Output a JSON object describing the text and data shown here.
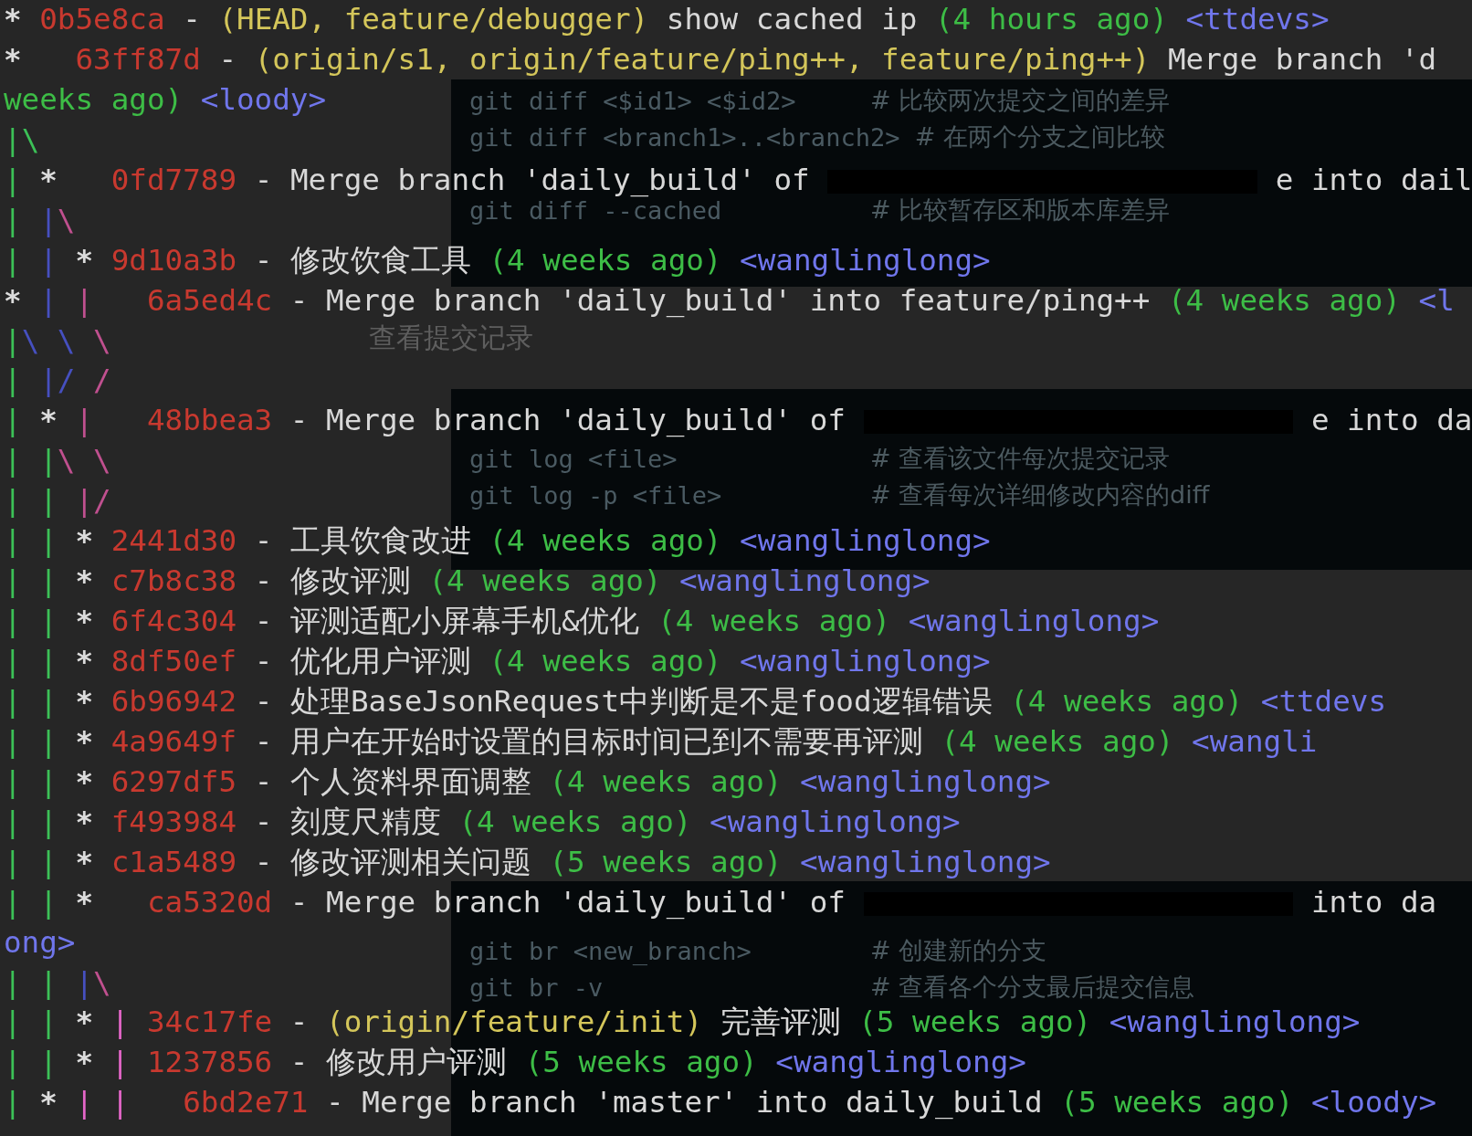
{
  "background_window": {
    "sections": [
      {
        "kind": "code",
        "lines": [
          {
            "code": "git diff <$id1> <$id2>",
            "comment": "# 比较两次提交之间的差异"
          },
          {
            "code": "git diff <branch1>..<branch2>",
            "comment": "# 在两个分支之间比较"
          },
          {
            "code": "git diff --cached",
            "comment": "# 比较暂存区和版本库差异"
          }
        ]
      },
      {
        "kind": "subheading",
        "text": "查看提交记录"
      },
      {
        "kind": "code",
        "lines": [
          {
            "code": "git log <file>",
            "comment": "# 查看该文件每次提交记录"
          },
          {
            "code": "git log -p <file>",
            "comment": "# 查看每次详细修改内容的diff"
          }
        ]
      },
      {
        "kind": "code",
        "lines": [
          {
            "code": "git br <new_branch>",
            "comment": "# 创建新的分支"
          },
          {
            "code": "git br -v",
            "comment": "# 查看各个分支最后提交信息"
          }
        ]
      }
    ]
  },
  "terminal": {
    "rows": [
      {
        "graph": [
          {
            "kind": "node",
            "text": "* ",
            "color": "#dcdcdc"
          }
        ],
        "parts": [
          {
            "kind": "hash",
            "text": "0b5e8ca"
          },
          {
            "kind": "dash",
            "text": "-"
          },
          {
            "kind": "refs",
            "text": "(HEAD, feature/debugger)"
          },
          {
            "kind": "message",
            "text": "show cached ip"
          },
          {
            "kind": "date",
            "text": "(4 hours ago)"
          },
          {
            "kind": "author",
            "text": "<ttdevs>"
          }
        ]
      },
      {
        "graph": [
          {
            "kind": "node",
            "text": "*   ",
            "color": "#dcdcdc"
          }
        ],
        "parts": [
          {
            "kind": "hash",
            "text": "63ff87d"
          },
          {
            "kind": "dash",
            "text": "-"
          },
          {
            "kind": "refs",
            "text": "(origin/s1, origin/feature/ping++, feature/ping++)"
          },
          {
            "kind": "message",
            "text": "Merge branch 'd"
          }
        ]
      },
      {
        "graph": [],
        "parts": [
          {
            "kind": "date",
            "text": "weeks ago)"
          },
          {
            "kind": "author",
            "text": "<loody>"
          }
        ]
      },
      {
        "graph": [
          {
            "kind": "line",
            "text": "|",
            "color": "#3cc157"
          },
          {
            "kind": "line",
            "text": "\\",
            "color": "#3cc157"
          }
        ],
        "parts": []
      },
      {
        "graph": [
          {
            "kind": "line",
            "text": "| ",
            "color": "#3cc157"
          },
          {
            "kind": "node",
            "text": "*   ",
            "color": "#dcdcdc"
          }
        ],
        "parts": [
          {
            "kind": "hash",
            "text": "0fd7789"
          },
          {
            "kind": "dash",
            "text": "-"
          },
          {
            "kind": "message",
            "text": "Merge branch 'daily_build' of"
          },
          {
            "kind": "redacted"
          },
          {
            "kind": "message",
            "text": "e into dail"
          }
        ]
      },
      {
        "graph": [
          {
            "kind": "line",
            "text": "| ",
            "color": "#3cc157"
          },
          {
            "kind": "line",
            "text": "|",
            "color": "#4650c0"
          },
          {
            "kind": "line",
            "text": "\\",
            "color": "#c0508f"
          }
        ],
        "parts": []
      },
      {
        "graph": [
          {
            "kind": "line",
            "text": "| ",
            "color": "#3cc157"
          },
          {
            "kind": "line",
            "text": "| ",
            "color": "#4650c0"
          },
          {
            "kind": "node",
            "text": "* ",
            "color": "#dcdcdc"
          }
        ],
        "parts": [
          {
            "kind": "hash",
            "text": "9d10a3b"
          },
          {
            "kind": "dash",
            "text": "-"
          },
          {
            "kind": "message",
            "text": "修改饮食工具"
          },
          {
            "kind": "date",
            "text": "(4 weeks ago)"
          },
          {
            "kind": "author",
            "text": "<wanglinglong>"
          }
        ]
      },
      {
        "graph": [
          {
            "kind": "node",
            "text": "* ",
            "color": "#dcdcdc"
          },
          {
            "kind": "line",
            "text": "| ",
            "color": "#4650c0"
          },
          {
            "kind": "line",
            "text": "|   ",
            "color": "#c0508f"
          }
        ],
        "parts": [
          {
            "kind": "hash",
            "text": "6a5ed4c"
          },
          {
            "kind": "dash",
            "text": "-"
          },
          {
            "kind": "message",
            "text": "Merge branch 'daily_build' into feature/ping++"
          },
          {
            "kind": "date",
            "text": "(4 weeks ago)"
          },
          {
            "kind": "author",
            "text": "<l"
          }
        ]
      },
      {
        "graph": [
          {
            "kind": "line",
            "text": "|",
            "color": "#3cc157"
          },
          {
            "kind": "line",
            "text": "\\ ",
            "color": "#4650c0"
          },
          {
            "kind": "line",
            "text": "\\ ",
            "color": "#4650c0"
          },
          {
            "kind": "line",
            "text": "\\",
            "color": "#c0508f"
          }
        ],
        "parts": []
      },
      {
        "graph": [
          {
            "kind": "line",
            "text": "| ",
            "color": "#3cc157"
          },
          {
            "kind": "line",
            "text": "|/ ",
            "color": "#4650c0"
          },
          {
            "kind": "line",
            "text": "/",
            "color": "#c0508f"
          }
        ],
        "parts": []
      },
      {
        "graph": [
          {
            "kind": "line",
            "text": "| ",
            "color": "#3cc157"
          },
          {
            "kind": "node",
            "text": "* ",
            "color": "#dcdcdc"
          },
          {
            "kind": "line",
            "text": "|   ",
            "color": "#c0508f"
          }
        ],
        "parts": [
          {
            "kind": "hash",
            "text": "48bbea3"
          },
          {
            "kind": "dash",
            "text": "-"
          },
          {
            "kind": "message",
            "text": "Merge branch 'daily_build' of"
          },
          {
            "kind": "redacted"
          },
          {
            "kind": "message",
            "text": "e into da"
          }
        ]
      },
      {
        "graph": [
          {
            "kind": "line",
            "text": "| ",
            "color": "#3cc157"
          },
          {
            "kind": "line",
            "text": "|",
            "color": "#3cc157"
          },
          {
            "kind": "line",
            "text": "\\ ",
            "color": "#c0508f"
          },
          {
            "kind": "line",
            "text": "\\",
            "color": "#c0508f"
          }
        ],
        "parts": []
      },
      {
        "graph": [
          {
            "kind": "line",
            "text": "| ",
            "color": "#3cc157"
          },
          {
            "kind": "line",
            "text": "| ",
            "color": "#3cc157"
          },
          {
            "kind": "line",
            "text": "|/",
            "color": "#c0508f"
          }
        ],
        "parts": []
      },
      {
        "graph": [
          {
            "kind": "line",
            "text": "| ",
            "color": "#3cc157"
          },
          {
            "kind": "line",
            "text": "| ",
            "color": "#3cc157"
          },
          {
            "kind": "node",
            "text": "* ",
            "color": "#dcdcdc"
          }
        ],
        "parts": [
          {
            "kind": "hash",
            "text": "2441d30"
          },
          {
            "kind": "dash",
            "text": "-"
          },
          {
            "kind": "message",
            "text": "工具饮食改进"
          },
          {
            "kind": "date",
            "text": "(4 weeks ago)"
          },
          {
            "kind": "author",
            "text": "<wanglinglong>"
          }
        ]
      },
      {
        "graph": [
          {
            "kind": "line",
            "text": "| ",
            "color": "#3cc157"
          },
          {
            "kind": "line",
            "text": "| ",
            "color": "#3cc157"
          },
          {
            "kind": "node",
            "text": "* ",
            "color": "#dcdcdc"
          }
        ],
        "parts": [
          {
            "kind": "hash",
            "text": "c7b8c38"
          },
          {
            "kind": "dash",
            "text": "-"
          },
          {
            "kind": "message",
            "text": "修改评测"
          },
          {
            "kind": "date",
            "text": "(4 weeks ago)"
          },
          {
            "kind": "author",
            "text": "<wanglinglong>"
          }
        ]
      },
      {
        "graph": [
          {
            "kind": "line",
            "text": "| ",
            "color": "#3cc157"
          },
          {
            "kind": "line",
            "text": "| ",
            "color": "#3cc157"
          },
          {
            "kind": "node",
            "text": "* ",
            "color": "#dcdcdc"
          }
        ],
        "parts": [
          {
            "kind": "hash",
            "text": "6f4c304"
          },
          {
            "kind": "dash",
            "text": "-"
          },
          {
            "kind": "message",
            "text": "评测适配小屏幕手机&优化"
          },
          {
            "kind": "date",
            "text": "(4 weeks ago)"
          },
          {
            "kind": "author",
            "text": "<wanglinglong>"
          }
        ]
      },
      {
        "graph": [
          {
            "kind": "line",
            "text": "| ",
            "color": "#3cc157"
          },
          {
            "kind": "line",
            "text": "| ",
            "color": "#3cc157"
          },
          {
            "kind": "node",
            "text": "* ",
            "color": "#dcdcdc"
          }
        ],
        "parts": [
          {
            "kind": "hash",
            "text": "8df50ef"
          },
          {
            "kind": "dash",
            "text": "-"
          },
          {
            "kind": "message",
            "text": "优化用户评测"
          },
          {
            "kind": "date",
            "text": "(4 weeks ago)"
          },
          {
            "kind": "author",
            "text": "<wanglinglong>"
          }
        ]
      },
      {
        "graph": [
          {
            "kind": "line",
            "text": "| ",
            "color": "#3cc157"
          },
          {
            "kind": "line",
            "text": "| ",
            "color": "#3cc157"
          },
          {
            "kind": "node",
            "text": "* ",
            "color": "#dcdcdc"
          }
        ],
        "parts": [
          {
            "kind": "hash",
            "text": "6b96942"
          },
          {
            "kind": "dash",
            "text": "-"
          },
          {
            "kind": "message",
            "text": "处理BaseJsonRequest中判断是不是food逻辑错误"
          },
          {
            "kind": "date",
            "text": "(4 weeks ago)"
          },
          {
            "kind": "author",
            "text": "<ttdevs"
          }
        ]
      },
      {
        "graph": [
          {
            "kind": "line",
            "text": "| ",
            "color": "#3cc157"
          },
          {
            "kind": "line",
            "text": "| ",
            "color": "#3cc157"
          },
          {
            "kind": "node",
            "text": "* ",
            "color": "#dcdcdc"
          }
        ],
        "parts": [
          {
            "kind": "hash",
            "text": "4a9649f"
          },
          {
            "kind": "dash",
            "text": "-"
          },
          {
            "kind": "message",
            "text": "用户在开始时设置的目标时间已到不需要再评测"
          },
          {
            "kind": "date",
            "text": "(4 weeks ago)"
          },
          {
            "kind": "author",
            "text": "<wangli"
          }
        ]
      },
      {
        "graph": [
          {
            "kind": "line",
            "text": "| ",
            "color": "#3cc157"
          },
          {
            "kind": "line",
            "text": "| ",
            "color": "#3cc157"
          },
          {
            "kind": "node",
            "text": "* ",
            "color": "#dcdcdc"
          }
        ],
        "parts": [
          {
            "kind": "hash",
            "text": "6297df5"
          },
          {
            "kind": "dash",
            "text": "-"
          },
          {
            "kind": "message",
            "text": "个人资料界面调整"
          },
          {
            "kind": "date",
            "text": "(4 weeks ago)"
          },
          {
            "kind": "author",
            "text": "<wanglinglong>"
          }
        ]
      },
      {
        "graph": [
          {
            "kind": "line",
            "text": "| ",
            "color": "#3cc157"
          },
          {
            "kind": "line",
            "text": "| ",
            "color": "#3cc157"
          },
          {
            "kind": "node",
            "text": "* ",
            "color": "#dcdcdc"
          }
        ],
        "parts": [
          {
            "kind": "hash",
            "text": "f493984"
          },
          {
            "kind": "dash",
            "text": "-"
          },
          {
            "kind": "message",
            "text": "刻度尺精度"
          },
          {
            "kind": "date",
            "text": "(4 weeks ago)"
          },
          {
            "kind": "author",
            "text": "<wanglinglong>"
          }
        ]
      },
      {
        "graph": [
          {
            "kind": "line",
            "text": "| ",
            "color": "#3cc157"
          },
          {
            "kind": "line",
            "text": "| ",
            "color": "#3cc157"
          },
          {
            "kind": "node",
            "text": "* ",
            "color": "#dcdcdc"
          }
        ],
        "parts": [
          {
            "kind": "hash",
            "text": "c1a5489"
          },
          {
            "kind": "dash",
            "text": "-"
          },
          {
            "kind": "message",
            "text": "修改评测相关问题"
          },
          {
            "kind": "date",
            "text": "(5 weeks ago)"
          },
          {
            "kind": "author",
            "text": "<wanglinglong>"
          }
        ]
      },
      {
        "graph": [
          {
            "kind": "line",
            "text": "| ",
            "color": "#3cc157"
          },
          {
            "kind": "line",
            "text": "| ",
            "color": "#3cc157"
          },
          {
            "kind": "node",
            "text": "*   ",
            "color": "#dcdcdc"
          }
        ],
        "parts": [
          {
            "kind": "hash",
            "text": "ca5320d"
          },
          {
            "kind": "dash",
            "text": "-"
          },
          {
            "kind": "message",
            "text": "Merge branch 'daily_build' of"
          },
          {
            "kind": "redacted"
          },
          {
            "kind": "message",
            "text": "into da"
          }
        ]
      },
      {
        "graph": [],
        "parts": [
          {
            "kind": "author",
            "text": "ong>"
          }
        ]
      },
      {
        "graph": [
          {
            "kind": "line",
            "text": "| ",
            "color": "#3cc157"
          },
          {
            "kind": "line",
            "text": "| ",
            "color": "#3cc157"
          },
          {
            "kind": "line",
            "text": "|",
            "color": "#4650c0"
          },
          {
            "kind": "line",
            "text": "\\",
            "color": "#c0508f"
          }
        ],
        "parts": []
      },
      {
        "graph": [
          {
            "kind": "line",
            "text": "| ",
            "color": "#3cc157"
          },
          {
            "kind": "line",
            "text": "| ",
            "color": "#3cc157"
          },
          {
            "kind": "node",
            "text": "* ",
            "color": "#dcdcdc"
          },
          {
            "kind": "line",
            "text": "| ",
            "color": "#e466c8"
          }
        ],
        "parts": [
          {
            "kind": "hash",
            "text": "34c17fe"
          },
          {
            "kind": "dash",
            "text": "-"
          },
          {
            "kind": "refs",
            "text": "(origin/feature/init)"
          },
          {
            "kind": "message",
            "text": "完善评测"
          },
          {
            "kind": "date",
            "text": "(5 weeks ago)"
          },
          {
            "kind": "author",
            "text": "<wanglinglong>"
          }
        ]
      },
      {
        "graph": [
          {
            "kind": "line",
            "text": "| ",
            "color": "#3cc157"
          },
          {
            "kind": "line",
            "text": "| ",
            "color": "#3cc157"
          },
          {
            "kind": "node",
            "text": "* ",
            "color": "#dcdcdc"
          },
          {
            "kind": "line",
            "text": "| ",
            "color": "#e466c8"
          }
        ],
        "parts": [
          {
            "kind": "hash",
            "text": "1237856"
          },
          {
            "kind": "dash",
            "text": "-"
          },
          {
            "kind": "message",
            "text": "修改用户评测"
          },
          {
            "kind": "date",
            "text": "(5 weeks ago)"
          },
          {
            "kind": "author",
            "text": "<wanglinglong>"
          }
        ]
      },
      {
        "graph": [
          {
            "kind": "line",
            "text": "| ",
            "color": "#3cc157"
          },
          {
            "kind": "node",
            "text": "* ",
            "color": "#dcdcdc"
          },
          {
            "kind": "line",
            "text": "| ",
            "color": "#e466c8"
          },
          {
            "kind": "line",
            "text": "|   ",
            "color": "#e466c8"
          }
        ],
        "parts": [
          {
            "kind": "hash",
            "text": "6bd2e71"
          },
          {
            "kind": "dash",
            "text": "-"
          },
          {
            "kind": "message",
            "text": "Merge branch 'master' into daily_build"
          },
          {
            "kind": "date",
            "text": "(5 weeks ago)"
          },
          {
            "kind": "author",
            "text": "<loody>"
          }
        ]
      }
    ]
  }
}
